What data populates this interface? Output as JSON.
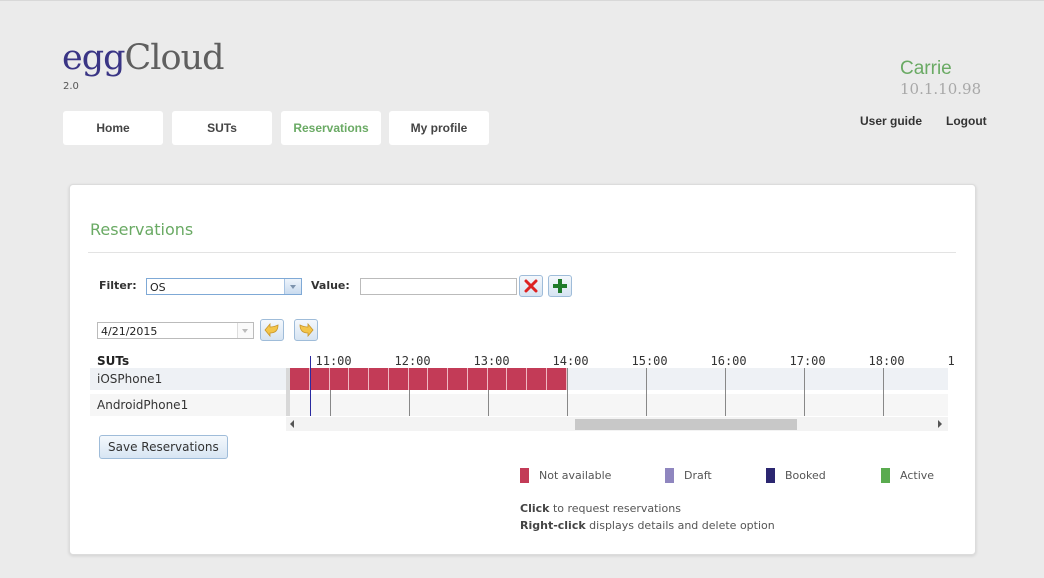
{
  "header": {
    "logo_part1": "egg",
    "logo_part2": "Cloud",
    "version": "2.0",
    "user_name": "Carrie",
    "user_ip": "10.1.10.98",
    "links": {
      "user_guide": "User guide",
      "logout": "Logout"
    }
  },
  "nav": {
    "items": [
      {
        "label": "Home",
        "active": false
      },
      {
        "label": "SUTs",
        "active": false
      },
      {
        "label": "Reservations",
        "active": true
      },
      {
        "label": "My profile",
        "active": false
      }
    ]
  },
  "page": {
    "title": "Reservations",
    "filter_label": "Filter:",
    "filter_value": "OS",
    "value_label": "Value:",
    "value_input": "",
    "date_value": "4/21/2015",
    "icons": {
      "clear": "close-icon",
      "add": "plus-icon",
      "prev_day": "arrow-back-icon",
      "next_day": "arrow-forward-icon"
    }
  },
  "timeline": {
    "suts_header": "SUTs",
    "hours": [
      "11:00",
      "12:00",
      "13:00",
      "14:00",
      "15:00",
      "16:00",
      "17:00",
      "18:00",
      "1"
    ],
    "view_start_hour": 10.5,
    "current_time": "10:45",
    "rows": [
      {
        "name": "iOSPhone1",
        "blocks": [
          {
            "start": "10:30",
            "end": "14:00",
            "status": "not_available",
            "slot_minutes": 15
          }
        ]
      },
      {
        "name": "AndroidPhone1",
        "blocks": []
      }
    ]
  },
  "save_button": "Save Reservations",
  "legend": [
    {
      "label": "Not available",
      "color": "#c33b57"
    },
    {
      "label": "Draft",
      "color": "#8f86bf"
    },
    {
      "label": "Booked",
      "color": "#2b2670"
    },
    {
      "label": "Active",
      "color": "#5aab4f"
    }
  ],
  "hints": [
    {
      "bold": "Click",
      "text": " to request reservations"
    },
    {
      "bold": "Right-click",
      "text": " displays details and delete option"
    }
  ]
}
